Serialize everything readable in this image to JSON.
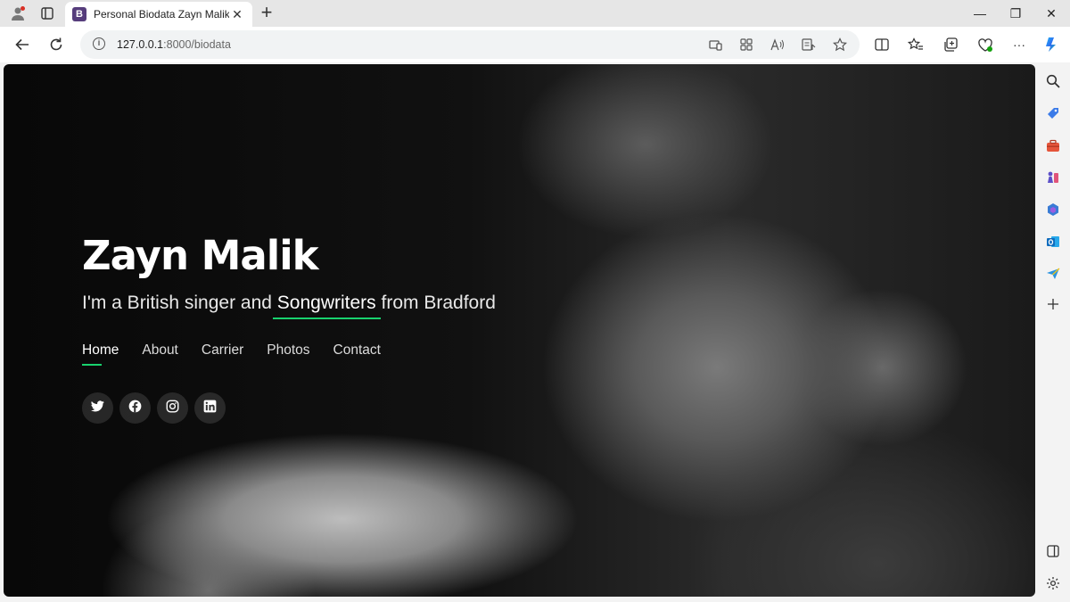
{
  "browser": {
    "tab": {
      "favicon_letter": "B",
      "title": "Personal Biodata Zayn Malik",
      "close_glyph": "✕"
    },
    "new_tab_glyph": "+",
    "url_host": "127.0.0.1",
    "url_path": ":8000/biodata",
    "more_glyph": "···",
    "window_controls": {
      "minimize": "—",
      "maximize": "❐",
      "close": "✕"
    }
  },
  "hero": {
    "name": "Zayn Malik",
    "subtitle_prefix": "I'm a British singer and ",
    "subtitle_role": "Songwriters",
    "subtitle_suffix": " from Bradford"
  },
  "nav": {
    "items": [
      "Home",
      "About",
      "Carrier",
      "Photos",
      "Contact"
    ],
    "active": "Home"
  },
  "socials": [
    {
      "name": "twitter-icon"
    },
    {
      "name": "facebook-icon"
    },
    {
      "name": "instagram-icon"
    },
    {
      "name": "linkedin-icon"
    }
  ],
  "colors": {
    "accent": "#18d26e",
    "tab_favicon": "#563d7c",
    "hero_text": "#ffffff"
  }
}
